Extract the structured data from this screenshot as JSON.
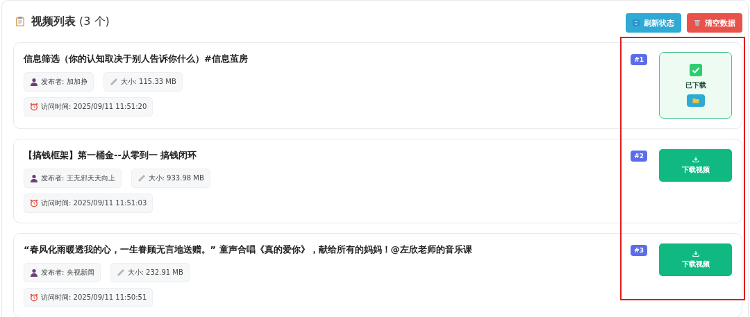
{
  "header": {
    "title": "视频列表",
    "count": "(3 个)"
  },
  "actions": [
    {
      "kind": "refresh",
      "label": "刷新状态"
    },
    {
      "kind": "clear",
      "label": "清空数据"
    }
  ],
  "videos": [
    {
      "title": "信息筛选（你的认知取决于别人告诉你什么）#信息茧房",
      "publisher": "发布者: 加加挣",
      "size": "大小: 115.33 MB",
      "visited": "访问时间: 2025/09/11 11:51:20",
      "index": "#1",
      "downloaded": true,
      "status": "已下载"
    },
    {
      "title": "【搞钱框架】第一桶金--从零到一 搞钱闭环",
      "publisher": "发布者: 王无邪天天向上",
      "size": "大小: 933.98 MB",
      "visited": "访问时间: 2025/09/11 11:51:03",
      "index": "#2",
      "downloaded": false,
      "status": "下载视频"
    },
    {
      "title": "“春风化雨暖透我的心，一生眷顾无言地送赠。” 童声合唱《真的爱你》，献给所有的妈妈！@左欣老师的音乐课",
      "publisher": "发布者: 央视新闻",
      "size": "大小: 232.91 MB",
      "visited": "访问时间: 2025/09/11 11:50:51",
      "index": "#3",
      "downloaded": false,
      "status": "下载视频"
    }
  ]
}
